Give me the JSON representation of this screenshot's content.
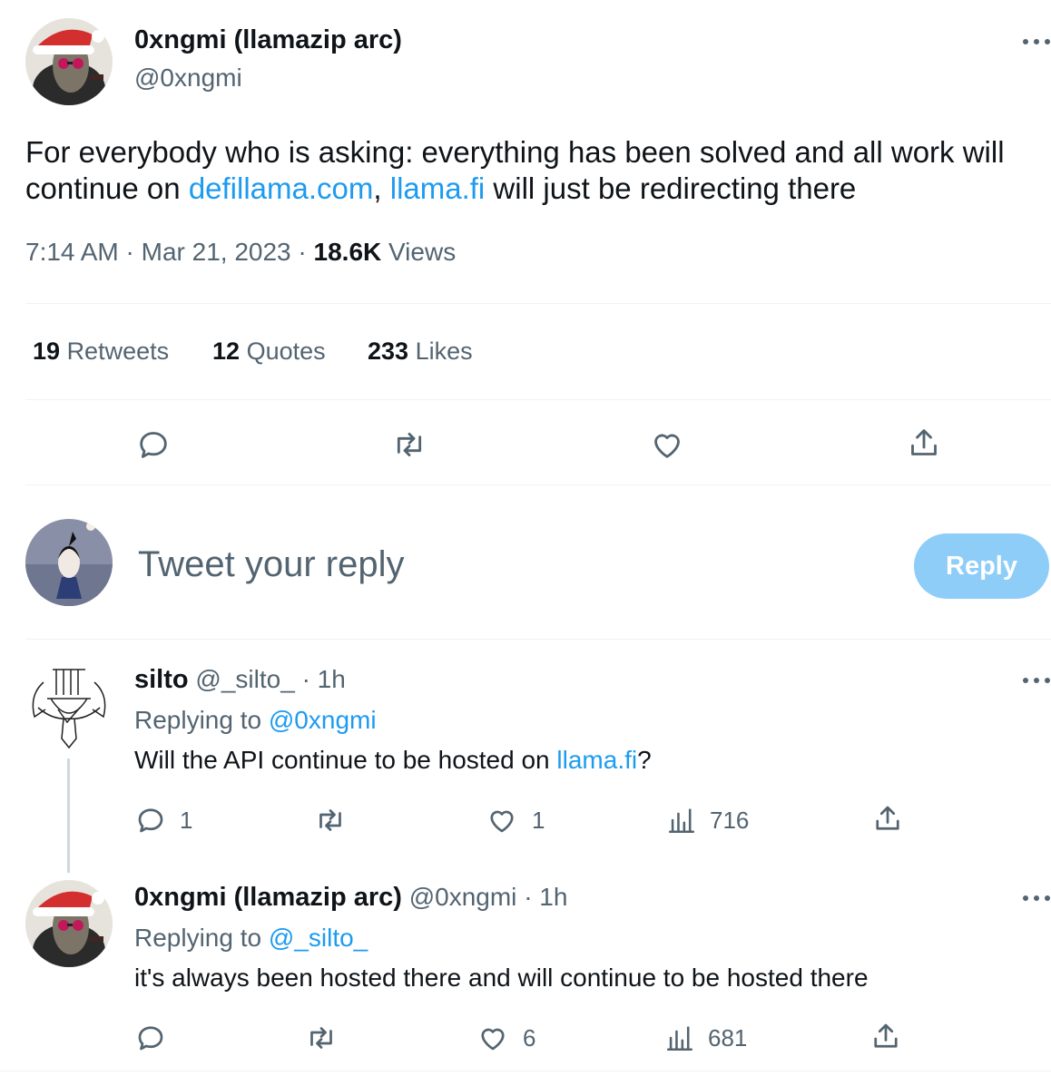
{
  "main_tweet": {
    "author_name": "0xngmi (llamazip arc)",
    "handle": "@0xngmi",
    "text_before": "For everybody who is asking: everything has been solved and all work will continue on ",
    "link1": "defillama.com",
    "text_mid": ", ",
    "link2": "llama.fi",
    "text_after": " will just be redirecting there",
    "time": "7:14 AM",
    "sep": "·",
    "date": "Mar 21, 2023",
    "views_count": "18.6K",
    "views_label": "Views",
    "retweets_count": "19",
    "retweets_label": "Retweets",
    "quotes_count": "12",
    "quotes_label": "Quotes",
    "likes_count": "233",
    "likes_label": "Likes"
  },
  "composer": {
    "placeholder": "Tweet your reply",
    "reply_button": "Reply"
  },
  "replies": [
    {
      "author_name": "silto",
      "handle": "@_silto_",
      "sep": "·",
      "time": "1h",
      "replying_label": "Replying to",
      "replying_handle": "@0xngmi",
      "text_before": "Will the API continue to be hosted on ",
      "link": "llama.fi",
      "text_after": "?",
      "reply_count": "1",
      "retweet_count": "",
      "like_count": "1",
      "view_count": "716"
    },
    {
      "author_name": "0xngmi (llamazip arc)",
      "handle": "@0xngmi",
      "sep": "·",
      "time": "1h",
      "replying_label": "Replying to",
      "replying_handle": "@_silto_",
      "text": "it's always been hosted there and will continue to be hosted there",
      "reply_count": "",
      "retweet_count": "",
      "like_count": "6",
      "view_count": "681"
    }
  ],
  "colors": {
    "accent": "#1d9bf0",
    "muted": "#536471",
    "reply_button_disabled": "#8ecdf8",
    "divider": "#eff3f4"
  },
  "icons": [
    "more-icon",
    "reply-icon",
    "retweet-icon",
    "like-icon",
    "share-icon",
    "views-icon"
  ]
}
